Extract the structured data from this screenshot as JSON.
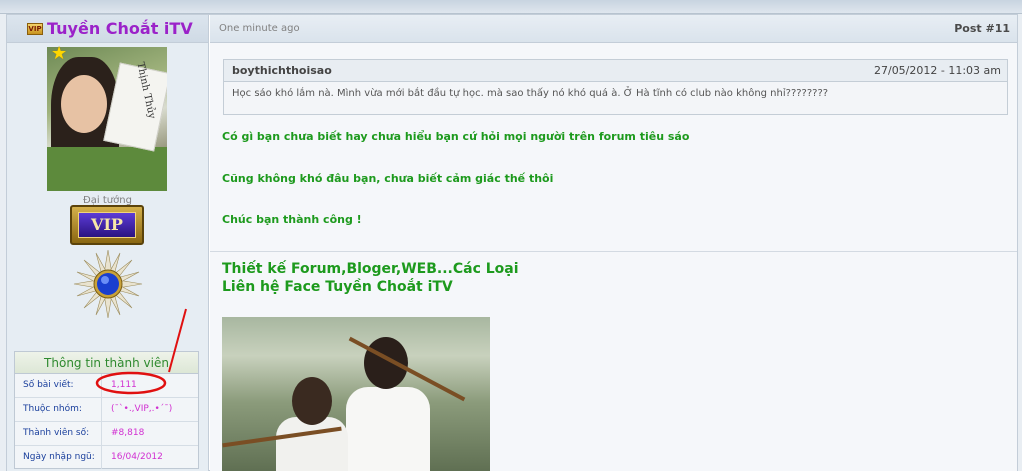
{
  "user": {
    "tag_label": "VIP",
    "username": "Tuyền Choắt iTV",
    "avatar_text": "Thịnh Thủy",
    "usertitle": "Đại tướng",
    "vip_badge": "VIP",
    "profile": {
      "header": "Thông tin thành viên",
      "rows": [
        {
          "label": "Số bài viết:",
          "value": "1,111"
        },
        {
          "label": "Thuộc nhóm:",
          "value": "(¯`•.,VIP,.•´¯)"
        },
        {
          "label": "Thành viên số:",
          "value": "#8,818"
        },
        {
          "label": "Ngày nhập ngũ:",
          "value": "16/04/2012"
        }
      ]
    }
  },
  "post": {
    "date": "One minute ago",
    "number": "Post #11",
    "quote": {
      "author": "boythichthoisao",
      "date": "27/05/2012 - 11:03 am",
      "text": "Học sáo khó lắm nà. Mình vừa mới bắt đầu tự học. mà sao thấy nó khó quá à. Ở Hà tĩnh có club nào không nhỉ????????"
    },
    "messages": [
      "Có gì bạn chưa biết hay chưa hiểu bạn cứ hỏi mọi người trên forum tiêu sáo",
      "Cũng không khó đâu bạn, chưa biết cảm giác thế thôi",
      "Chúc bạn thành công !"
    ],
    "signature": {
      "line1": "Thiết kế Forum,Bloger,WEB...Các Loại",
      "line2_prefix": "Liên hệ ",
      "line2_link": "Face Tuyền Choắt iTV"
    }
  },
  "colors": {
    "username": "#9b22c9",
    "message_green": "#1d9a1d",
    "profile_value": "#d12fd1",
    "profile_label": "#1a3f9c",
    "annotation_red": "#e01010"
  }
}
